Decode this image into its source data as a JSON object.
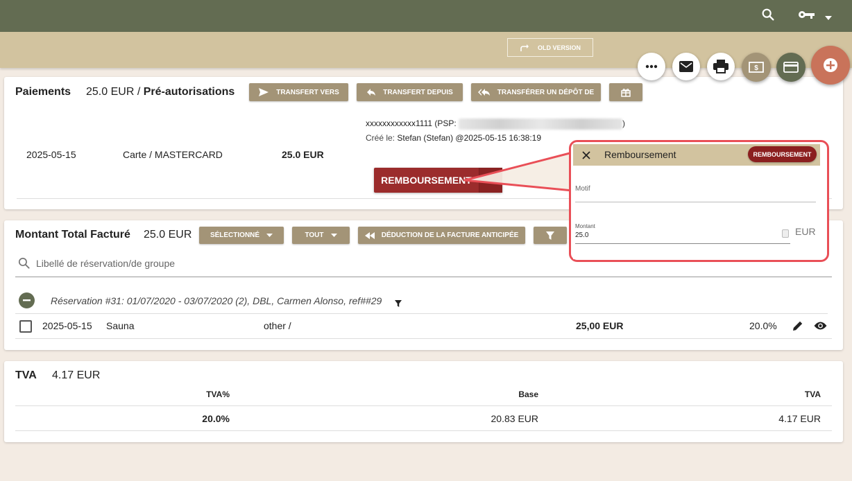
{
  "header": {
    "old_version_label": "OLD VERSION"
  },
  "payments": {
    "title": "Paiements",
    "amount": "25.0 EUR",
    "separator": "/",
    "preauth_label": "Pré-autorisations",
    "buttons": {
      "transfer_to": "TRANSFERT VERS",
      "transfer_from": "TRANSFERT DEPUIS",
      "transfer_deposit": "TRANSFÉRER UN DÉPÔT DE"
    },
    "row": {
      "date": "2025-05-15",
      "method": "Carte / MASTERCARD",
      "amount": "25.0 EUR",
      "card_number": "xxxxxxxxxxxx1111 (PSP:",
      "psp_close": ")",
      "created_prefix": "Créé le:",
      "created_value": "Stefan (Stefan) @2025-05-15 16:38:19",
      "refund_button": "REMBOURSEMENT"
    }
  },
  "refund_panel": {
    "title": "Remboursement",
    "action_button": "REMBOURSEMENT",
    "motif_label": "Motif",
    "montant_label": "Montant",
    "montant_value": "25.0",
    "currency": "EUR"
  },
  "billing": {
    "title": "Montant Total Facturé",
    "amount": "25.0 EUR",
    "buttons": {
      "selected": "SÉLECTIONNÉ",
      "all": "TOUT",
      "deduction": "DÉDUCTION DE LA FACTURE ANTICIPÉE"
    },
    "search_placeholder": "Libellé de réservation/de groupe",
    "group_label": "Réservation #31: 01/07/2020 - 03/07/2020 (2), DBL, Carmen Alonso, ref##29",
    "item": {
      "date": "2025-05-15",
      "name": "Sauna",
      "category": "other /",
      "amount": "25,00 EUR",
      "vat": "20.0%"
    }
  },
  "vat": {
    "title": "TVA",
    "amount": "4.17 EUR",
    "headers": {
      "rate": "TVA%",
      "base": "Base",
      "vat": "TVA"
    },
    "row": {
      "rate": "20.0%",
      "base": "20.83 EUR",
      "vat": "4.17 EUR"
    }
  },
  "colors": {
    "topbar": "#636c52",
    "subbar": "#d2c39f",
    "button": "#a39477",
    "refund_red": "#9b2c2c",
    "callout": "#e94f57",
    "fab_add": "#c9735a"
  },
  "icons": [
    "search-icon",
    "key-icon",
    "chevron-down-icon",
    "more-icon",
    "mail-icon",
    "print-icon",
    "cash-icon",
    "credit-card-icon",
    "add-icon",
    "send-icon",
    "reply-icon",
    "reply-all-icon",
    "gift-icon",
    "close-icon",
    "filter-icon",
    "rewind-icon",
    "collapse-icon",
    "edit-icon",
    "eye-icon"
  ]
}
